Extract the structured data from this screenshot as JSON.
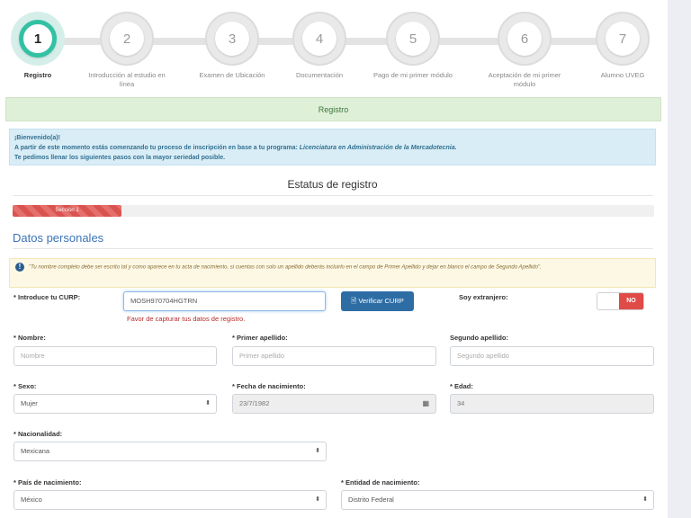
{
  "stepper": {
    "steps": [
      {
        "num": "1",
        "label": "Registro"
      },
      {
        "num": "2",
        "label": "Introducción al estudio en línea"
      },
      {
        "num": "3",
        "label": "Examen de Ubicación"
      },
      {
        "num": "4",
        "label": "Documentación"
      },
      {
        "num": "5",
        "label": "Pago de mi primer módulo"
      },
      {
        "num": "6",
        "label": "Aceptación de mi primer módulo"
      },
      {
        "num": "7",
        "label": "Alumno UVEG"
      }
    ],
    "active": 1,
    "accent": "#33c1a4"
  },
  "panel": {
    "title": "Registro"
  },
  "info": {
    "welcome": "¡Bienvenido(a)!",
    "line1_prefix": "A partir de este momento estás comenzando tu proceso de inscripción en base a tu programa:",
    "program": "Licenciatura en Administración de la Mercadotecnia.",
    "line2": "Te pedimos llenar los siguientes pasos con la mayor seriedad posible."
  },
  "status": {
    "title": "Estatus de registro",
    "progress_label": "Sección 1",
    "progress_fraction": 0.17
  },
  "section": {
    "title": "Datos personales"
  },
  "warning": {
    "text": "\"Tu nombre completo debe ser escrito tal y como aparece en tu acta de nacimiento, si cuentas con solo un apellido deberás incluirlo en el campo de Primer Apellido y dejar en blanco el campo de Segundo Apellido\"."
  },
  "form": {
    "curp_label": "* Introduce tu CURP:",
    "curp_value": "MOSH970704HGTRN",
    "verify_button": "Verificar CURP",
    "curp_error": "Favor de capturar tus datos de registro.",
    "foreign_label": "Soy extranjero:",
    "foreign_toggle": "NO",
    "nombre_label": "* Nombre:",
    "nombre_placeholder": "Nombre",
    "primer_label": "* Primer apellido:",
    "primer_placeholder": "Primer apellido",
    "segundo_label": "Segundo apellido:",
    "segundo_placeholder": "Segundo apellido",
    "sexo_label": "* Sexo:",
    "sexo_value": "Mujer",
    "fecha_label": "* Fecha de nacimiento:",
    "fecha_value": "23/7/1982",
    "edad_label": "* Edad:",
    "edad_value": "34",
    "nacionalidad_label": "* Nacionalidad:",
    "nacionalidad_value": "Mexicana",
    "pais_label": "* País de nacimiento:",
    "pais_value": "México",
    "entidad_label": "* Entidad de nacimiento:",
    "entidad_value": "Distrito Federal"
  },
  "colors": {
    "primary_button": "#2e6da4",
    "error": "#b52b2b",
    "toggle_no": "#e04b47"
  }
}
